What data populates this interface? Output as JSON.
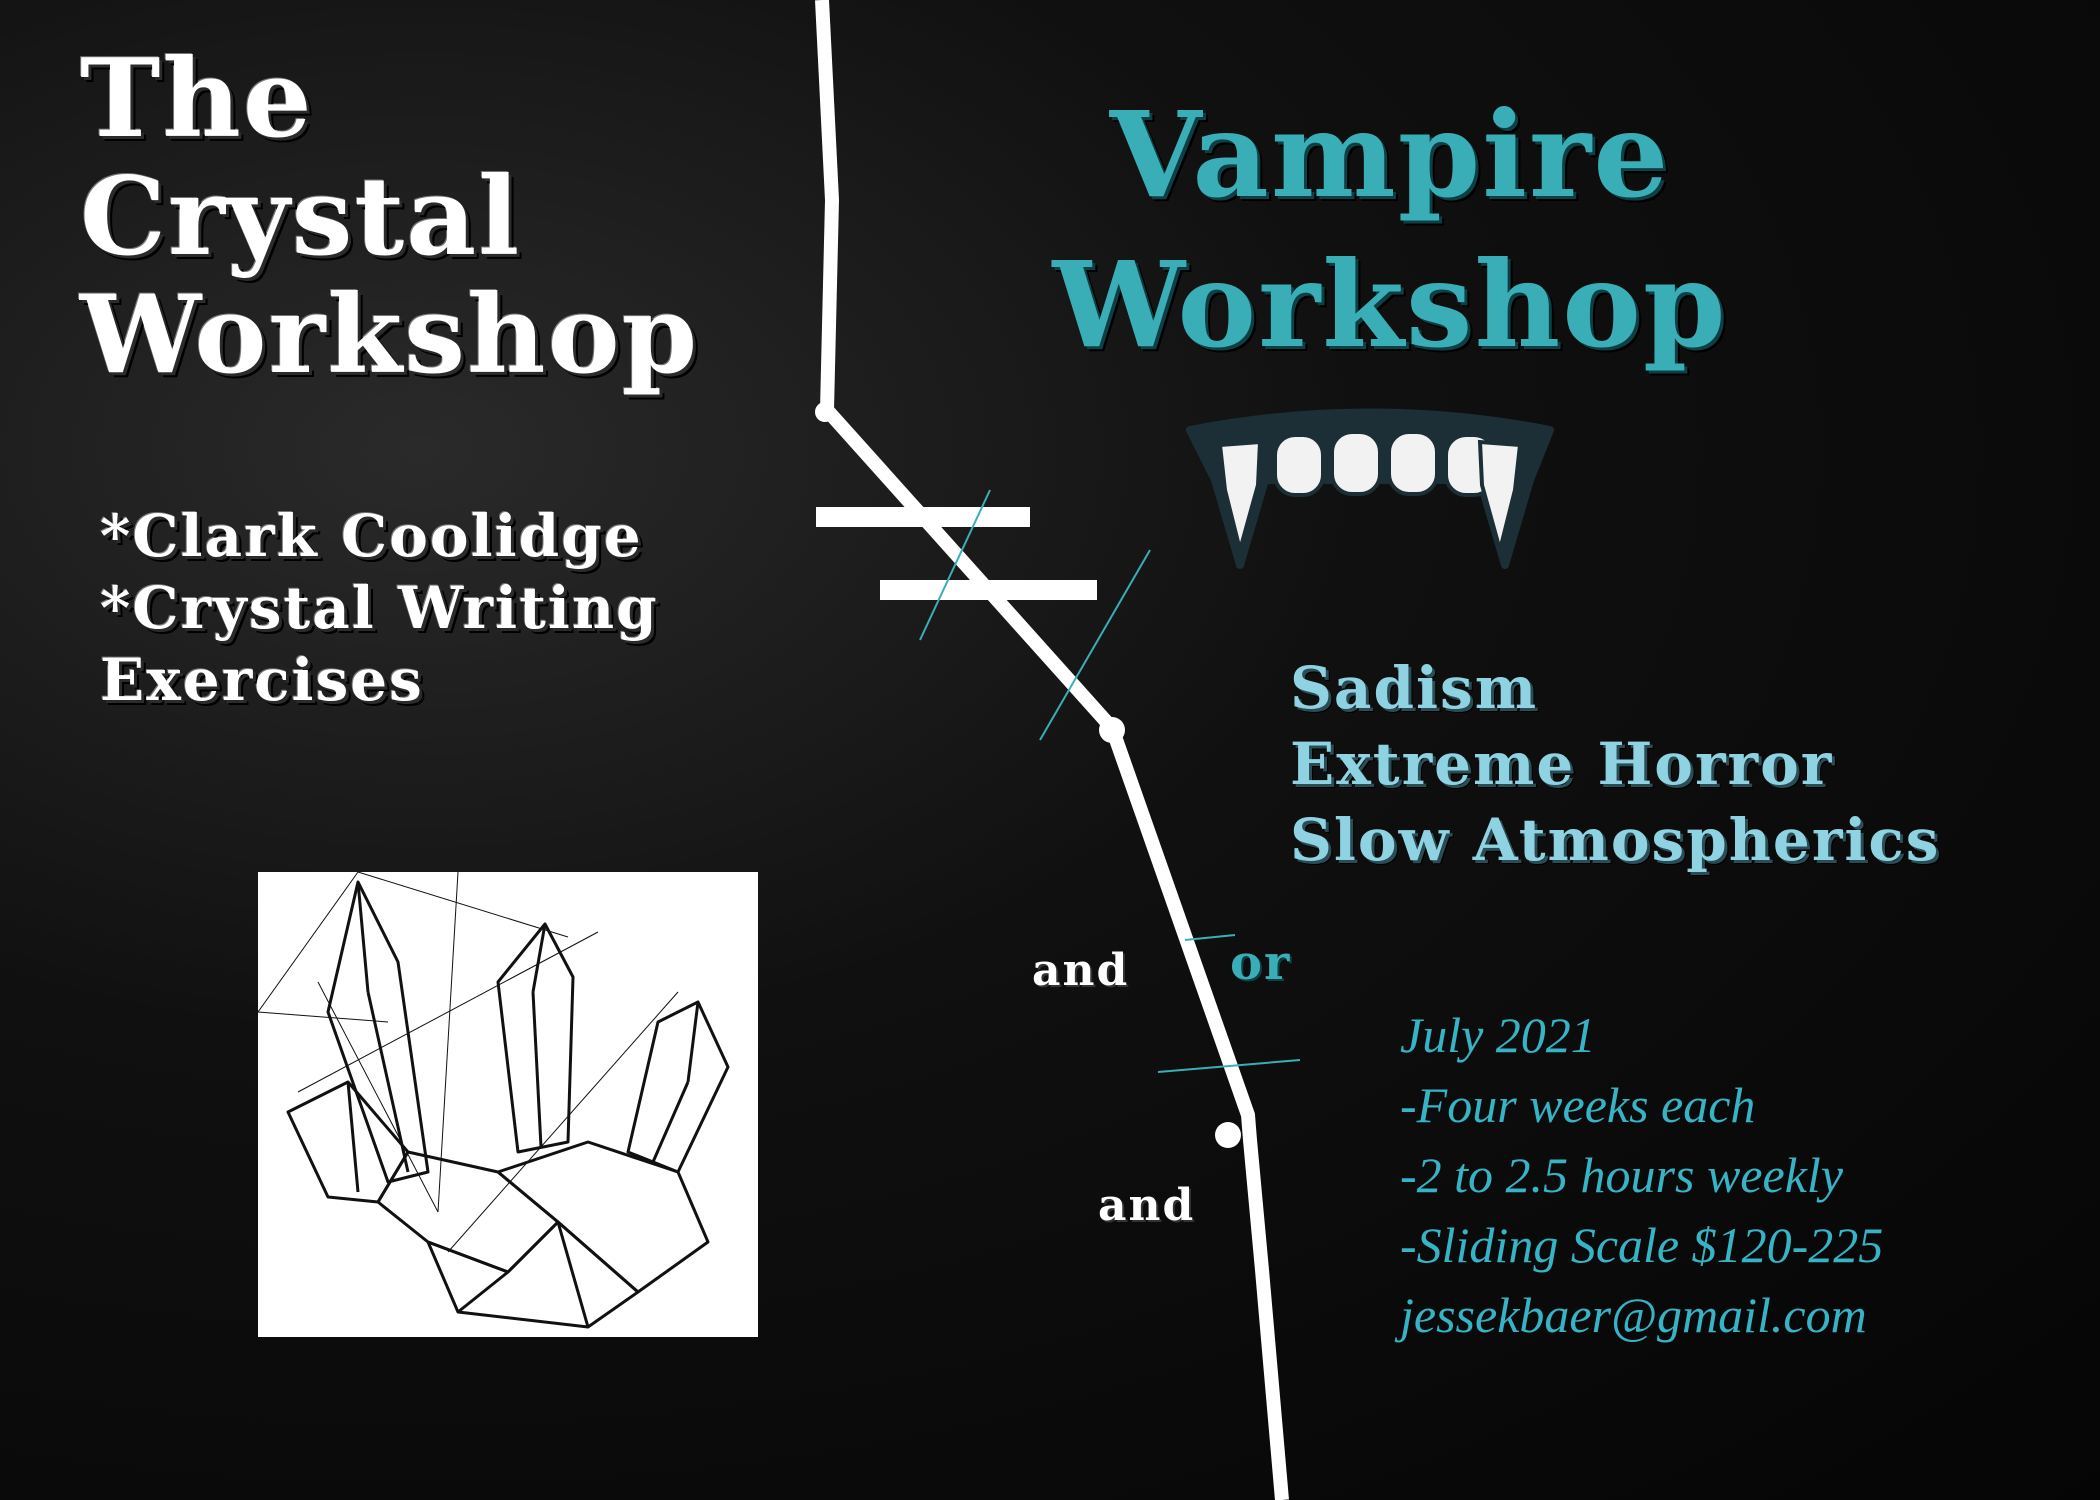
{
  "left": {
    "title_lines": [
      "The",
      "Crystal",
      "Workshop"
    ],
    "bullets": [
      "*Clark Coolidge",
      "*Crystal Writing",
      "Exercises"
    ]
  },
  "right": {
    "title_lines": [
      "Vampire",
      "Workshop"
    ],
    "topics": [
      "Sadism",
      "Extreme Horror",
      "Slow Atmospherics"
    ],
    "details": [
      "July 2021",
      "-Four weeks each",
      "-2 to 2.5 hours weekly",
      "-Sliding Scale $120-225",
      "jessekbaer@gmail.com"
    ]
  },
  "connectors": {
    "and_1": "and",
    "or": "or",
    "and_2": "and"
  },
  "icons": {
    "fangs": "vampire-fangs-icon",
    "crystal": "crystal-cluster-illustration",
    "not-equal": "not-equal-sign"
  },
  "colors": {
    "background": "#0d0d0d",
    "teal": "#3aaeb7",
    "light_blue": "#8fd3e3",
    "white": "#ffffff"
  }
}
